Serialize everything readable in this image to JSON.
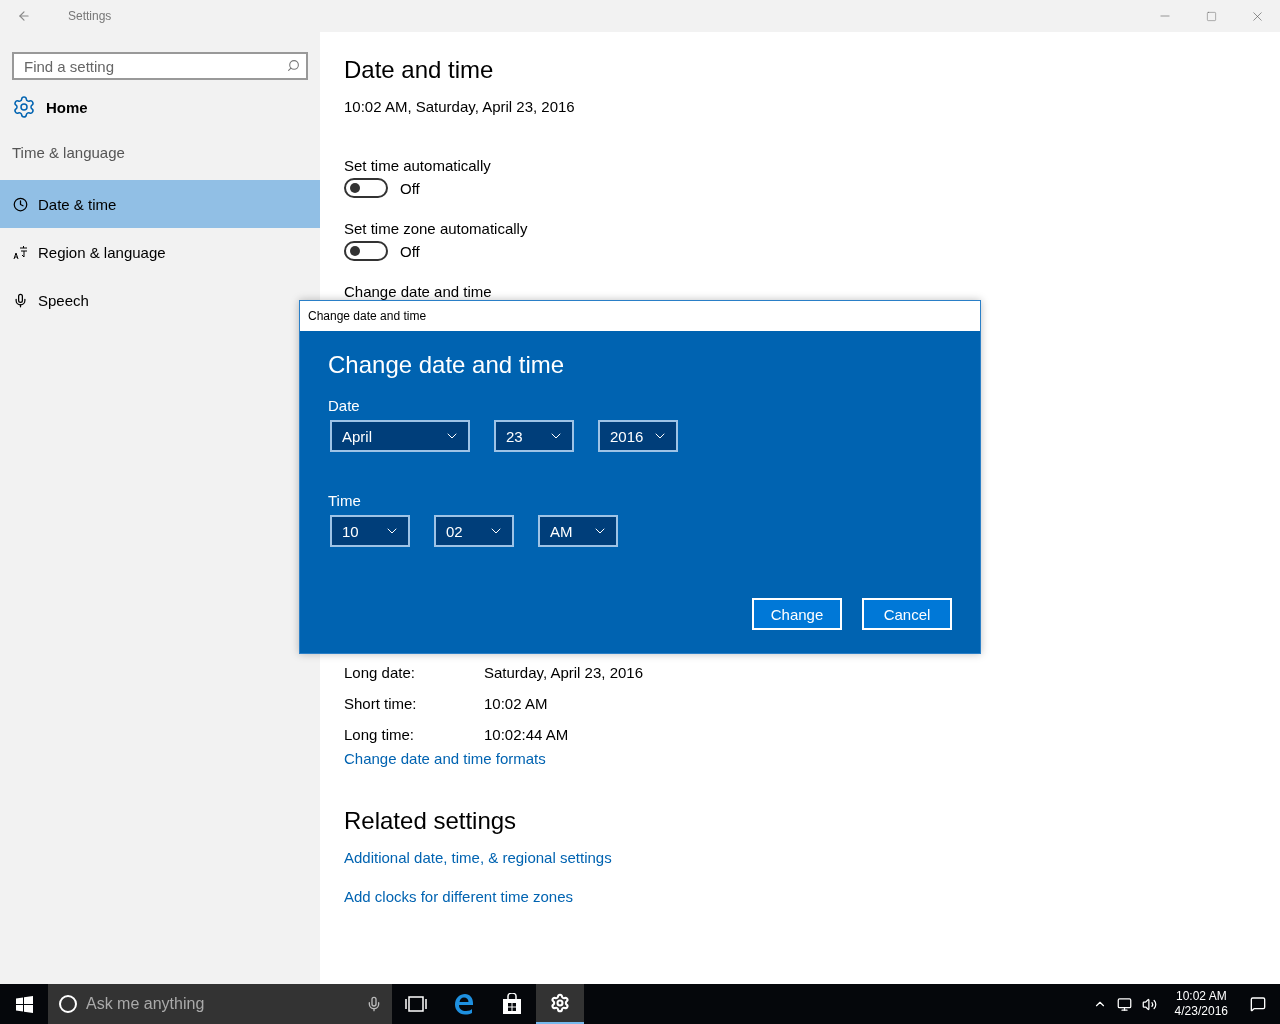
{
  "window": {
    "title": "Settings"
  },
  "sidebar": {
    "search": {
      "placeholder": "Find a setting"
    },
    "home": "Home",
    "section": "Time & language",
    "items": [
      {
        "label": "Date & time",
        "kind": "clock",
        "selected": true
      },
      {
        "label": "Region & language",
        "kind": "region",
        "selected": false
      },
      {
        "label": "Speech",
        "kind": "mic",
        "selected": false
      }
    ]
  },
  "content": {
    "heading": "Date and time",
    "current": "10:02 AM, Saturday, April 23, 2016",
    "toggles": [
      {
        "label": "Set time automatically",
        "on": false,
        "state": "Off"
      },
      {
        "label": "Set time zone automatically",
        "on": false,
        "state": "Off"
      }
    ],
    "change_heading": "Change date and time",
    "formats": [
      {
        "label": "Long date:",
        "value": "Saturday, April 23, 2016"
      },
      {
        "label": "Short time:",
        "value": "10:02 AM"
      },
      {
        "label": "Long time:",
        "value": "10:02:44 AM"
      }
    ],
    "formats_link": "Change date and time formats",
    "related_heading": "Related settings",
    "related_links": [
      "Additional date, time, & regional settings",
      "Add clocks for different time zones"
    ]
  },
  "dialog": {
    "title": "Change date and time",
    "heading": "Change date and time",
    "groups": [
      {
        "label": "Date",
        "fields": [
          {
            "value": "April",
            "kind": "wide"
          },
          {
            "value": "23",
            "kind": "narrow"
          },
          {
            "value": "2016",
            "kind": "narrow"
          }
        ]
      },
      {
        "label": "Time",
        "fields": [
          {
            "value": "10",
            "kind": "narrow"
          },
          {
            "value": "02",
            "kind": "narrow"
          },
          {
            "value": "AM",
            "kind": "narrow"
          }
        ]
      }
    ],
    "buttons": [
      "Change",
      "Cancel"
    ]
  },
  "taskbar": {
    "search": {
      "placeholder": "Ask me anything"
    },
    "apps": [
      {
        "kind": "taskview",
        "selected": false
      },
      {
        "kind": "edge",
        "selected": false
      },
      {
        "kind": "store",
        "selected": false
      },
      {
        "kind": "settings",
        "selected": true
      }
    ],
    "time": "10:02 AM",
    "date": "4/23/2016"
  }
}
